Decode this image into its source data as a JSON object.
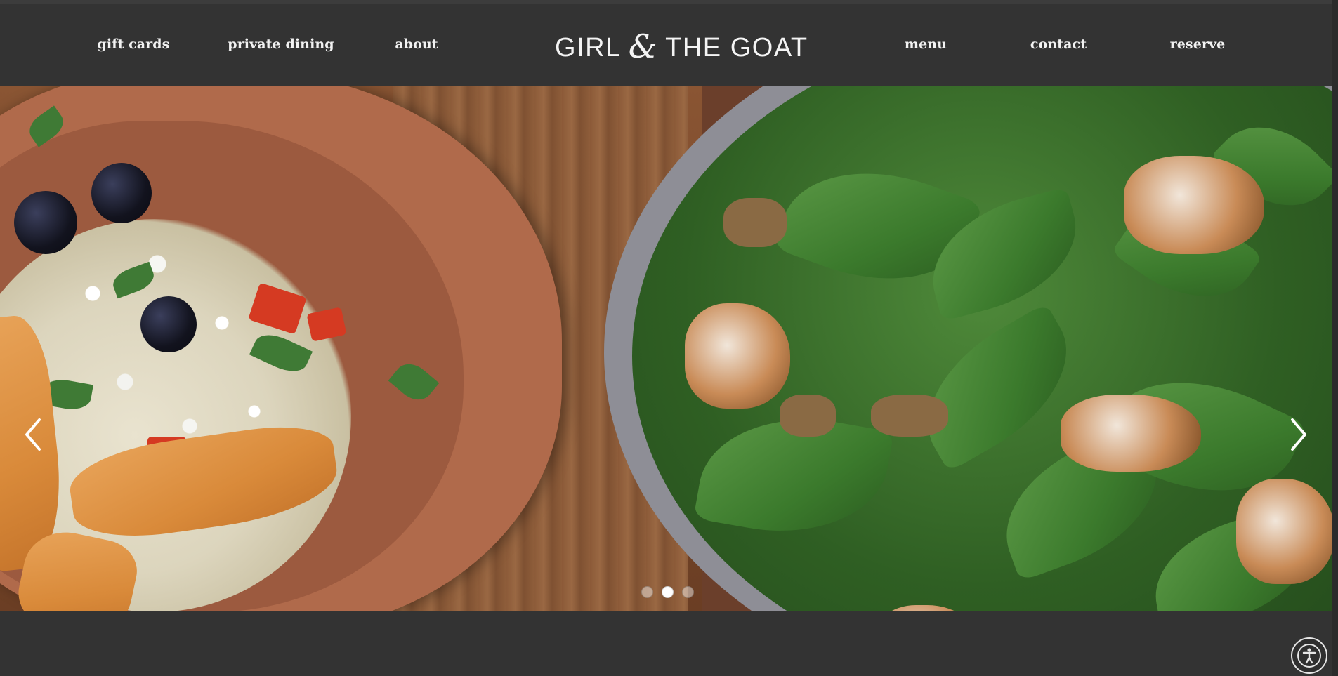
{
  "header": {
    "nav_left": [
      {
        "label": "gift cards"
      },
      {
        "label": "private dining"
      },
      {
        "label": "about"
      }
    ],
    "logo": {
      "part1": "GIRL",
      "amp": "&",
      "part2": "THE GOAT"
    },
    "nav_right": [
      {
        "label": "menu"
      },
      {
        "label": "contact"
      },
      {
        "label": "reserve"
      }
    ]
  },
  "hero": {
    "slides_count": 3,
    "active_slide": 2,
    "prev_icon": "chevron-left-icon",
    "next_icon": "chevron-right-icon"
  },
  "accessibility": {
    "icon": "accessibility-icon"
  },
  "colors": {
    "background": "#333333",
    "nav_text": "#f2f2f2",
    "dot_active": "#ffffff",
    "dot_inactive": "rgba(255,255,255,0.45)"
  }
}
